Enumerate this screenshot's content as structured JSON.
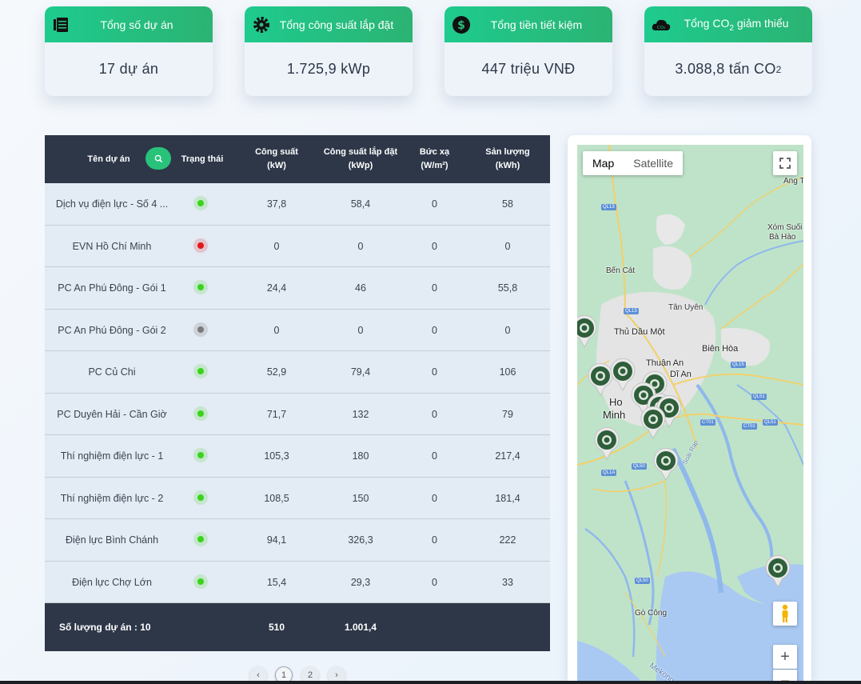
{
  "cards": [
    {
      "title": "Tổng số dự án",
      "value": "17 dự án",
      "icon": "bills-icon"
    },
    {
      "title": "Tổng công suất lắp đặt",
      "value": "1.725,9 kWp",
      "icon": "gear-icon"
    },
    {
      "title": "Tổng tiền tiết kiệm",
      "value": "447 triệu VNĐ",
      "icon": "dollar-icon"
    },
    {
      "title_main": "Tổng CO",
      "title_sub": "2",
      "title_end": " giảm thiểu",
      "value_main": "3.088,8 tấn CO",
      "value_sub": "2",
      "icon": "cloud-co2-icon"
    }
  ],
  "table": {
    "headers": {
      "name": "Tên dự án",
      "status": "Trạng thái",
      "power_1": "Công suất",
      "power_2": "(kW)",
      "installed_1": "Công suất lắp đặt",
      "installed_2": "(kWp)",
      "radiation_1": "Bức xạ",
      "radiation_2": "(W/m²)",
      "output_1": "Sản lượng",
      "output_2": "(kWh)"
    },
    "rows": [
      {
        "name": "Dịch vụ điện lực - Số 4 ...",
        "status": "online",
        "power": "37,8",
        "installed": "58,4",
        "radiation": "0",
        "output": "58"
      },
      {
        "name": "EVN Hồ Chí Minh",
        "status": "error",
        "power": "0",
        "installed": "0",
        "radiation": "0",
        "output": "0"
      },
      {
        "name": "PC An Phú Đông - Gói 1",
        "status": "online",
        "power": "24,4",
        "installed": "46",
        "radiation": "0",
        "output": "55,8"
      },
      {
        "name": "PC An Phú Đông - Gói 2",
        "status": "offline",
        "power": "0",
        "installed": "0",
        "radiation": "0",
        "output": "0"
      },
      {
        "name": "PC Củ Chi",
        "status": "online",
        "power": "52,9",
        "installed": "79,4",
        "radiation": "0",
        "output": "106"
      },
      {
        "name": "PC Duyên Hải - Cần Giờ",
        "status": "online",
        "power": "71,7",
        "installed": "132",
        "radiation": "0",
        "output": "79"
      },
      {
        "name": "Thí nghiệm điện lực - 1",
        "status": "online",
        "power": "105,3",
        "installed": "180",
        "radiation": "0",
        "output": "217,4"
      },
      {
        "name": "Thí nghiệm điện lực - 2",
        "status": "online",
        "power": "108,5",
        "installed": "150",
        "radiation": "0",
        "output": "181,4"
      },
      {
        "name": "Điện lực Bình Chánh",
        "status": "online",
        "power": "94,1",
        "installed": "326,3",
        "radiation": "0",
        "output": "222"
      },
      {
        "name": "Điện lực Chợ Lớn",
        "status": "online",
        "power": "15,4",
        "installed": "29,3",
        "radiation": "0",
        "output": "33"
      }
    ],
    "footer": {
      "label": "Số lượng dự án : 10",
      "power_total": "510",
      "installed_total": "1.001,4"
    }
  },
  "pagination": {
    "prev": "‹",
    "pages": [
      "1",
      "2"
    ],
    "current": "1",
    "next": "›"
  },
  "map": {
    "toggle_map": "Map",
    "toggle_satellite": "Satellite",
    "fullscreen_icon": "fullscreen-icon",
    "zoom_in": "+",
    "zoom_out": "−",
    "labels": [
      "Ang Ta",
      "Xóm Suối",
      "Bà Hào",
      "Bến Cát",
      "Tân Uyên",
      "Thủ Dầu Một",
      "Biên Hòa",
      "Thuận An",
      "Dĩ An",
      "Ho",
      "Minh",
      "Gò Công",
      "Mekong",
      "Soài Rạp"
    ],
    "roads": [
      "QL13",
      "QL13",
      "QL15",
      "QL51",
      "QL51",
      "CT01",
      "CT01",
      "QL50",
      "QL1A",
      "QL50"
    ]
  },
  "colors": {
    "header_dark": "#2d3748",
    "accent_green": "#29c27a",
    "status_online": "#39d41a",
    "status_error": "#e01818",
    "status_offline": "#7a7a7a"
  }
}
